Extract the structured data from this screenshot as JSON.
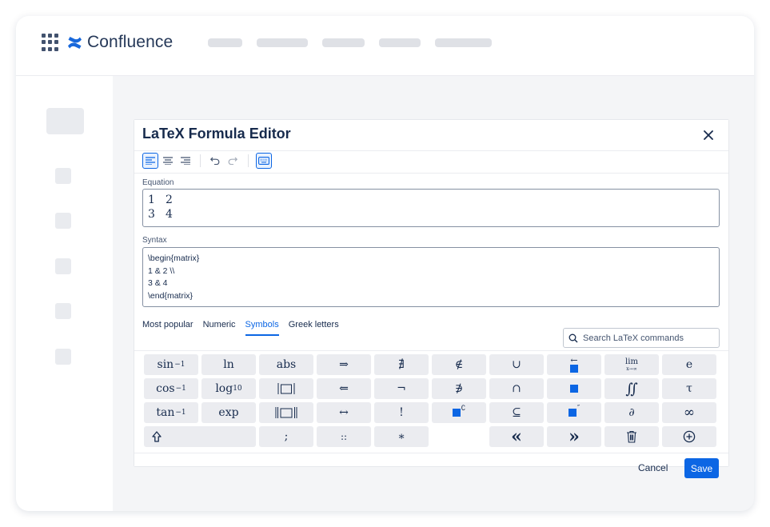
{
  "app": {
    "name": "Confluence"
  },
  "dialog": {
    "title": "LaTeX Formula Editor",
    "equation_label": "Equation",
    "equation_rows": [
      [
        "1",
        "2"
      ],
      [
        "3",
        "4"
      ]
    ],
    "syntax_label": "Syntax",
    "syntax_lines": [
      "\\begin{matrix}",
      "1 & 2 \\\\",
      "3 & 4",
      "\\end{matrix}"
    ],
    "tabs": [
      {
        "label": "Most popular",
        "selected": false
      },
      {
        "label": "Numeric",
        "selected": false
      },
      {
        "label": "Symbols",
        "selected": true
      },
      {
        "label": "Greek letters",
        "selected": false
      }
    ],
    "search_placeholder": "Search LaTeX commands",
    "keys": {
      "sin": "sin",
      "cos": "cos",
      "tan": "tan",
      "inv": "−1",
      "ln": "ln",
      "log": "log",
      "log_sub": "10",
      "exp": "exp",
      "abs": "abs",
      "implies": "⇒",
      "impliedby": "⇐",
      "iff": "↔",
      "nexists": "∄",
      "neg": "¬",
      "factorial": "!",
      "notin": "∉",
      "notni": "∌",
      "complement_sup": "∁",
      "cup": "∪",
      "cap": "∩",
      "subseteq": "⊆",
      "overleftarrow": "←",
      "dprime": "″",
      "lim": "lim",
      "lim_sub": "x→∞",
      "iint": "∬",
      "partial": "∂",
      "e": "e",
      "tau": "τ",
      "infty": "∞",
      "semicolon": ";",
      "coloncolon": "::",
      "ast": "∗",
      "laquo": "«",
      "raquo": "»"
    },
    "cancel_label": "Cancel",
    "save_label": "Save"
  },
  "colors": {
    "accent": "#0c66e4",
    "key_bg": "#ebecf0",
    "brand": "#1868db"
  }
}
